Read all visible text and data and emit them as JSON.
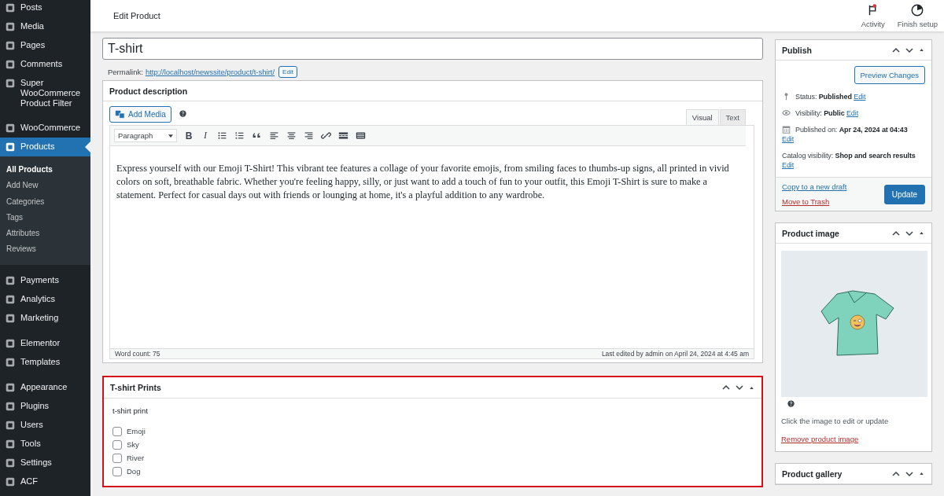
{
  "sidebar": {
    "groups": [
      {
        "items": [
          {
            "label": "Posts",
            "selected": false
          },
          {
            "label": "Media",
            "selected": false
          },
          {
            "label": "Pages",
            "selected": false
          },
          {
            "label": "Comments",
            "selected": false
          },
          {
            "label": "Super WooCommerce Product Filter",
            "selected": false
          }
        ]
      },
      {
        "items": [
          {
            "label": "WooCommerce",
            "selected": false
          },
          {
            "label": "Products",
            "selected": true,
            "children": [
              {
                "label": "All Products",
                "selected": true
              },
              {
                "label": "Add New",
                "selected": false
              },
              {
                "label": "Categories",
                "selected": false
              },
              {
                "label": "Tags",
                "selected": false
              },
              {
                "label": "Attributes",
                "selected": false
              },
              {
                "label": "Reviews",
                "selected": false
              }
            ]
          }
        ]
      },
      {
        "items": [
          {
            "label": "Payments",
            "selected": false
          },
          {
            "label": "Analytics",
            "selected": false
          },
          {
            "label": "Marketing",
            "selected": false
          }
        ]
      },
      {
        "items": [
          {
            "label": "Elementor",
            "selected": false
          },
          {
            "label": "Templates",
            "selected": false
          }
        ]
      },
      {
        "items": [
          {
            "label": "Appearance",
            "selected": false
          },
          {
            "label": "Plugins",
            "selected": false
          },
          {
            "label": "Users",
            "selected": false
          },
          {
            "label": "Tools",
            "selected": false
          },
          {
            "label": "Settings",
            "selected": false
          },
          {
            "label": "ACF",
            "selected": false
          }
        ]
      }
    ]
  },
  "header": {
    "title": "Edit Product",
    "actions": [
      {
        "label": "Activity",
        "kind": "activity",
        "alert": true
      },
      {
        "label": "Finish setup",
        "kind": "progress",
        "alert": false
      }
    ]
  },
  "title_field": {
    "value": "T-shirt"
  },
  "permalink": {
    "label": "Permalink:",
    "url": "http://localhost/newssite/product/t-shirt/",
    "button": "Edit"
  },
  "description": {
    "title": "Product description",
    "add_media": "Add Media",
    "tabs": [
      {
        "label": "Visual",
        "selected": true
      },
      {
        "label": "Text",
        "selected": false
      }
    ],
    "format": "Paragraph",
    "toolbar": [
      {
        "kind": "bold",
        "text": "B"
      },
      {
        "kind": "italic",
        "text": "I"
      },
      {
        "kind": "bullets"
      },
      {
        "kind": "numbers"
      },
      {
        "kind": "quote"
      },
      {
        "kind": "align-left"
      },
      {
        "kind": "align-center"
      },
      {
        "kind": "align-right"
      },
      {
        "kind": "link"
      },
      {
        "kind": "more"
      },
      {
        "kind": "toolbar"
      }
    ],
    "content": "Express yourself with our Emoji T-Shirt! This vibrant tee features a collage of your favorite emojis, from smiling faces to thumbs-up signs, all printed in vivid colors on soft, breathable fabric. Whether you're feeling happy, silly, or just want to add a touch of fun to your outfit, this Emoji T-Shirt is sure to make a statement. Perfect for casual days out with friends or lounging at home, it's a playful addition to any wardrobe.",
    "word_count": "Word count: 75",
    "last_edited": "Last edited by admin on April 24, 2024 at 4:45 am"
  },
  "prints": {
    "title": "T-shirt Prints",
    "highlighted": true,
    "label": "t-shirt print",
    "options": [
      {
        "label": "Emoji",
        "checked": false
      },
      {
        "label": "Sky",
        "checked": false
      },
      {
        "label": "River",
        "checked": false
      },
      {
        "label": "Dog",
        "checked": false
      }
    ]
  },
  "publish": {
    "title": "Publish",
    "preview": "Preview Changes",
    "rows": [
      {
        "kind": "pin",
        "label": "Status:",
        "value": "Published",
        "link": "Edit"
      },
      {
        "kind": "eye",
        "label": "Visibility:",
        "value": "Public",
        "link": "Edit"
      },
      {
        "kind": "calendar",
        "label": "Published on:",
        "value": "Apr 24, 2024 at 04:43",
        "link": "Edit"
      },
      {
        "kind": "none",
        "label": "Catalog visibility:",
        "value": "Shop and search results",
        "link": "Edit"
      }
    ],
    "copy": "Copy to a new draft",
    "trash": "Move to Trash",
    "update": "Update"
  },
  "product_image": {
    "title": "Product image",
    "hint": "Click the image to edit or update",
    "remove": "Remove product image"
  },
  "product_gallery": {
    "title": "Product gallery"
  }
}
